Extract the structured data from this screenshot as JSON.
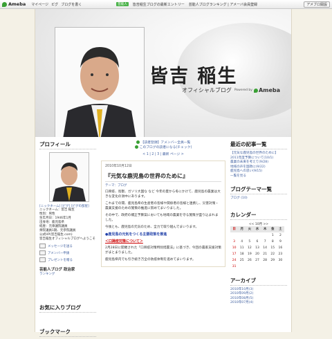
{
  "topbar": {
    "brand": "Ameba",
    "nav": [
      "マイページ",
      "ピグ",
      "ブログを書く"
    ],
    "badge": "芸能人",
    "notice": "皆吉稲生ブログの最新エントリー",
    "links": "芸能人ブログランキング | アメーバ会員登録",
    "button": "アメブロ開設"
  },
  "header": {
    "name": "皆吉 稲生",
    "subtitle": "オフィシャルブログ",
    "powered": "Powered by",
    "brand": "Ameba"
  },
  "left": {
    "profile_title": "プロフィール",
    "profile_links": "[ニックネーム] [ピグ] [ピグの部屋]",
    "profile_lines": [
      "ニックネーム：皆吉 稲生",
      "性別：男性",
      "生年月日：1946年1月",
      "出身地：鹿児島県",
      "経歴：元衆議院議員",
      "衆院議員1期、元参院議員",
      "公式HP(皆吉稲生.com)",
      "皆吉稲生オフィシャルブログへようこそ"
    ],
    "actions": [
      "メッセージを送る",
      "アメンバー申請",
      "プレゼントを贈る"
    ],
    "rank": "芸能人ブログ 政治家",
    "rank_sub": "ランキング",
    "fav_title": "お気に入りブログ",
    "bookmark_title": "ブックマーク"
  },
  "mid": {
    "top_links": [
      "【読者登録】アメンバー全員一覧",
      "このブログの読者になる(チェック)"
    ],
    "pager": "< 1 | 2 | 3 | 最新 ページ >",
    "date": "2010年10月12日",
    "title": "『元気な鹿児島の世界のために』",
    "theme": "テーマ：ブログ",
    "paragraphs": [
      "口蹄疫、鳥獣、ガソリ大国な など 今年の夏から冬にかけて、鹿児島の農業は大きな変化の渦中にあります。",
      "これまでの間、鹿児島県の生産者の皆様や関係者の皆様と連携し、災害対策・農業支援のための施策の推進に努めてまいりました。",
      "その中で、政府の補正予算案においても地域の農業を守る施策が盛り込まれました。",
      "今後とも、鹿児島の元気のため、全力で取り組んでまいります。"
    ],
    "highlight_blue": "●鹿児島の元気をつくる主要政策を推進",
    "highlight_red": "＜口蹄疫対策について＞",
    "tail": [
      "2月28日に開催された「口蹄疫対策特別措置法」に基づき、今回の農家支援対策がまとまりました。",
      "鹿児島県内でも引き続き万全の防疫体制を進めてまいります。"
    ]
  },
  "right": {
    "recent_title": "最近の記事一覧",
    "recent": [
      "【元気な鹿児島の世界のために】",
      "2011年度予算について(10/1)",
      "農業の未来を考えて(9/28)",
      "地域の声を国政に(9/22)",
      "鹿児島への思い(9/15)",
      "一覧を見る"
    ],
    "theme_title": "ブログテーマ一覧",
    "theme_item": "ブログ (10)",
    "calendar_title": "カレンダー",
    "calendar_month": "<< 10月 >>",
    "weekdays": [
      "日",
      "月",
      "火",
      "水",
      "木",
      "金",
      "土"
    ],
    "weeks": [
      [
        "",
        "",
        "",
        "",
        "",
        "1",
        "2"
      ],
      [
        "3",
        "4",
        "5",
        "6",
        "7",
        "8",
        "9"
      ],
      [
        "10",
        "11",
        "12",
        "13",
        "14",
        "15",
        "16"
      ],
      [
        "17",
        "18",
        "19",
        "20",
        "21",
        "22",
        "23"
      ],
      [
        "24",
        "25",
        "26",
        "27",
        "28",
        "29",
        "30"
      ],
      [
        "31",
        "",
        "",
        "",
        "",
        "",
        ""
      ]
    ],
    "archive_title": "アーカイブ",
    "archive": [
      "2010年10月(3)",
      "2010年09月(2)",
      "2010年08月(5)",
      "2010年07月(4)"
    ]
  }
}
